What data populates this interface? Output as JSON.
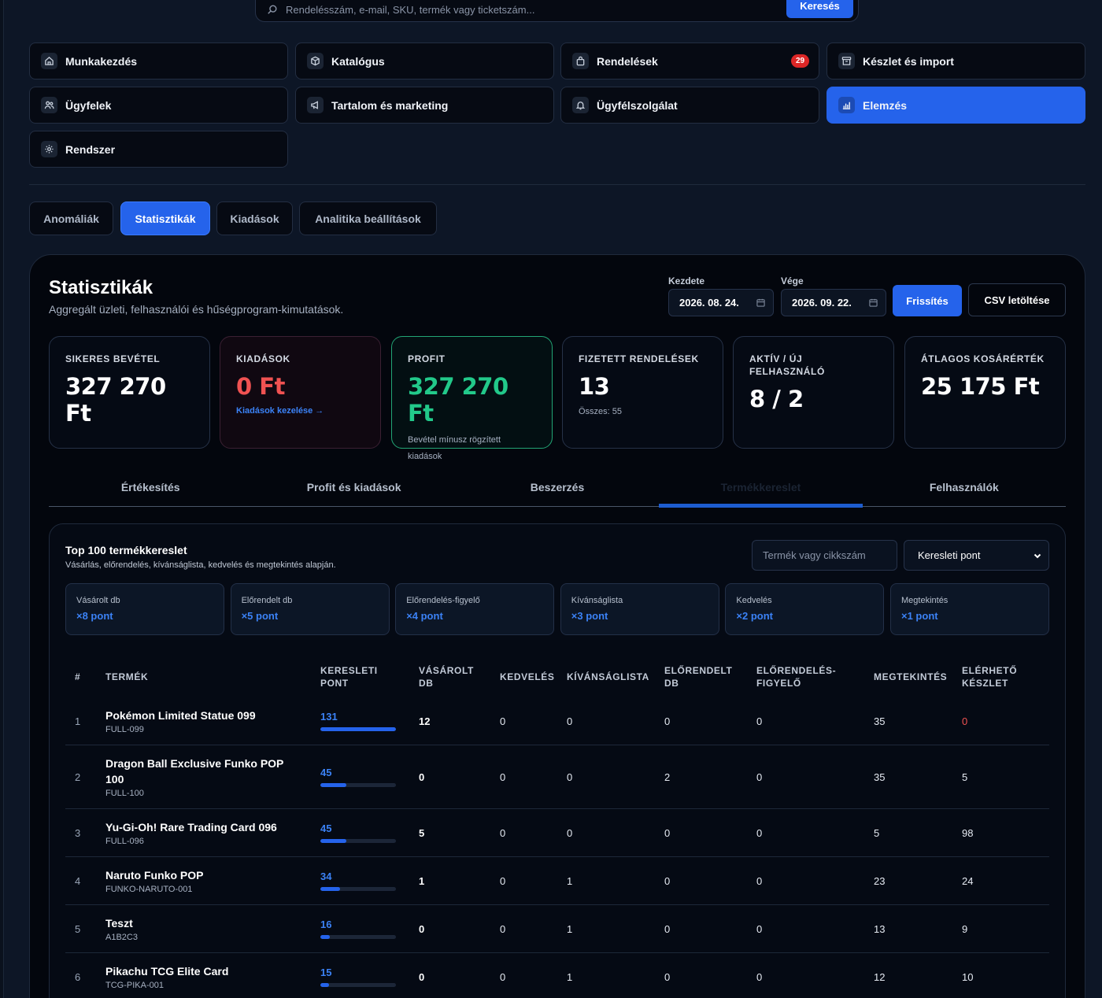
{
  "search": {
    "placeholder": "Rendelésszám, e-mail, SKU, termék vagy ticketszám...",
    "button": "Keresés"
  },
  "nav": [
    {
      "label": "Munkakezdés",
      "icon": "home-icon"
    },
    {
      "label": "Katalógus",
      "icon": "box-icon"
    },
    {
      "label": "Rendelések",
      "icon": "bag-icon",
      "badge": "29"
    },
    {
      "label": "Készlet és import",
      "icon": "archive-icon"
    },
    {
      "label": "Ügyfelek",
      "icon": "users-icon"
    },
    {
      "label": "Tartalom és marketing",
      "icon": "megaphone-icon"
    },
    {
      "label": "Ügyfélszolgálat",
      "icon": "bell-icon"
    },
    {
      "label": "Elemzés",
      "icon": "chart-icon",
      "active": true
    },
    {
      "label": "Rendszer",
      "icon": "gear-icon"
    }
  ],
  "section_tabs": [
    {
      "label": "Anomáliák"
    },
    {
      "label": "Statisztikák",
      "active": true
    },
    {
      "label": "Kiadások"
    },
    {
      "label": "Analitika beállítások"
    }
  ],
  "panel": {
    "title": "Statisztikák",
    "subtitle": "Aggregált üzleti, felhasználói és hűségprogram-kimutatások.",
    "start_label": "Kezdete",
    "start_value": "2026. 08. 24.",
    "end_label": "Vége",
    "end_value": "2026. 09. 22.",
    "refresh": "Frissítés",
    "csv": "CSV letöltése"
  },
  "kpis": [
    {
      "label": "Sikeres bevétel",
      "value": "327 270 Ft"
    },
    {
      "label": "Kiadások",
      "value": "0 Ft",
      "link": "Kiadások kezelése →"
    },
    {
      "label": "Profit",
      "value": "327 270 Ft",
      "note": "Bevétel mínusz rögzített kiadások"
    },
    {
      "label": "Fizetett rendelések",
      "value": "13",
      "note": "Összes: 55"
    },
    {
      "label": "Aktív / új felhasználó",
      "value": "8 / 2"
    },
    {
      "label": "Átlagos kosárérték",
      "value": "25 175 Ft"
    }
  ],
  "subtabs": [
    {
      "label": "Értékesítés"
    },
    {
      "label": "Profit és kiadások"
    },
    {
      "label": "Beszerzés"
    },
    {
      "label": "Termékkereslet",
      "active": true
    },
    {
      "label": "Felhasználók"
    }
  ],
  "demand": {
    "title": "Top 100 termékkereslet",
    "subtitle": "Vásárlás, előrendelés, kívánságlista, kedvelés és megtekintés alapján.",
    "filter_placeholder": "Termék vagy cikkszám",
    "sort_value": "Keresleti pont",
    "weights": [
      {
        "label": "Vásárolt db",
        "value": "×8 pont"
      },
      {
        "label": "Előrendelt db",
        "value": "×5 pont"
      },
      {
        "label": "Előrendelés-figyelő",
        "value": "×4 pont"
      },
      {
        "label": "Kívánságlista",
        "value": "×3 pont"
      },
      {
        "label": "Kedvelés",
        "value": "×2 pont"
      },
      {
        "label": "Megtekintés",
        "value": "×1 pont"
      }
    ],
    "columns": [
      "#",
      "Termék",
      "Keresleti pont",
      "Vásárolt db",
      "Kedvelés",
      "Kívánságlista",
      "Előrendelt db",
      "Előrendelés-figyelő",
      "Megtekintés",
      "Elérhető készlet"
    ],
    "rows": [
      {
        "rank": "1",
        "name": "Pokémon Limited Statue 099",
        "sku": "FULL-099",
        "score": "131",
        "score_pct": 1.0,
        "purchased": "12",
        "likes": "0",
        "wishlist": "0",
        "preordered": "0",
        "watchers": "0",
        "views": "35",
        "stock": "0",
        "stock_red": true
      },
      {
        "rank": "2",
        "name": "Dragon Ball Exclusive Funko POP 100",
        "sku": "FULL-100",
        "score": "45",
        "score_pct": 0.34,
        "purchased": "0",
        "likes": "0",
        "wishlist": "0",
        "preordered": "2",
        "watchers": "0",
        "views": "35",
        "stock": "5"
      },
      {
        "rank": "3",
        "name": "Yu-Gi-Oh! Rare Trading Card 096",
        "sku": "FULL-096",
        "score": "45",
        "score_pct": 0.34,
        "purchased": "5",
        "likes": "0",
        "wishlist": "0",
        "preordered": "0",
        "watchers": "0",
        "views": "5",
        "stock": "98"
      },
      {
        "rank": "4",
        "name": "Naruto Funko POP",
        "sku": "FUNKO-NARUTO-001",
        "score": "34",
        "score_pct": 0.26,
        "purchased": "1",
        "likes": "0",
        "wishlist": "1",
        "preordered": "0",
        "watchers": "0",
        "views": "23",
        "stock": "24"
      },
      {
        "rank": "5",
        "name": "Teszt",
        "sku": "A1B2C3",
        "score": "16",
        "score_pct": 0.12,
        "purchased": "0",
        "likes": "0",
        "wishlist": "1",
        "preordered": "0",
        "watchers": "0",
        "views": "13",
        "stock": "9"
      },
      {
        "rank": "6",
        "name": "Pikachu TCG Elite Card",
        "sku": "TCG-PIKA-001",
        "score": "15",
        "score_pct": 0.11,
        "purchased": "0",
        "likes": "0",
        "wishlist": "1",
        "preordered": "0",
        "watchers": "0",
        "views": "12",
        "stock": "10"
      }
    ]
  }
}
